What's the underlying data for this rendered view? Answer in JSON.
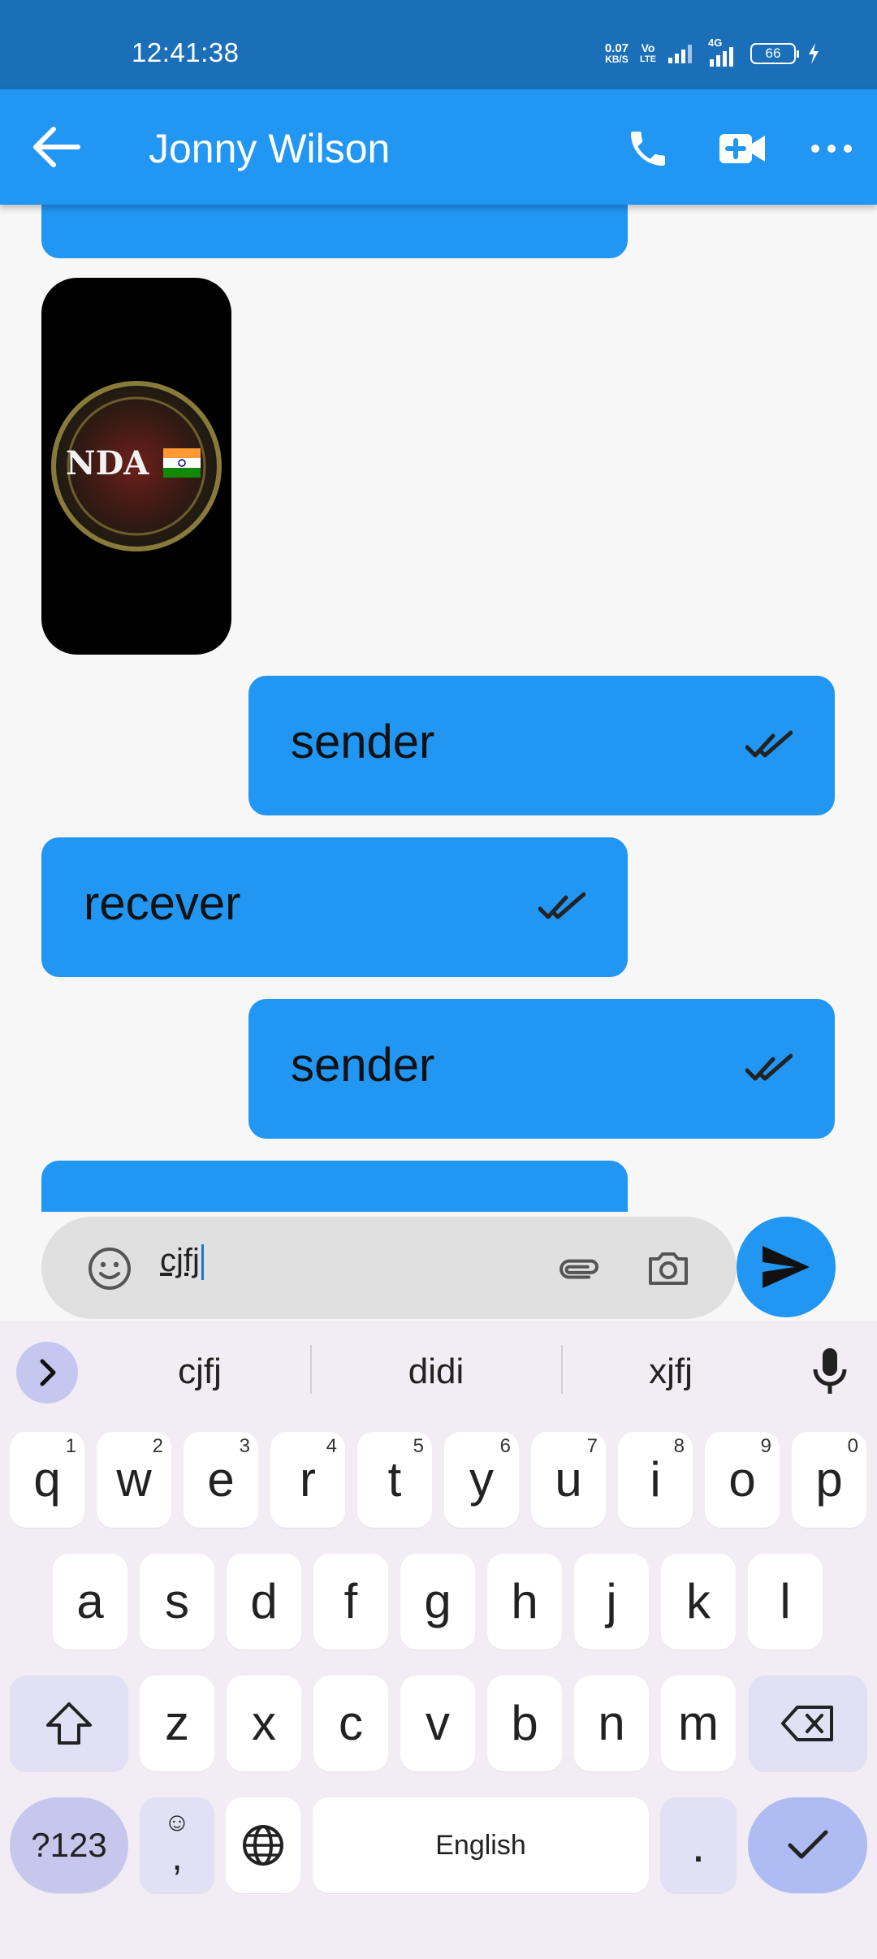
{
  "status_bar": {
    "time": "12:41:38",
    "net_speed_value": "0.07",
    "net_speed_unit": "KB/S",
    "volte_top": "Vo",
    "volte_bottom": "LTE",
    "network_4g": "4G",
    "battery": "66"
  },
  "app_bar": {
    "title": "Jonny Wilson",
    "back_icon": "arrow-left-icon",
    "call_icon": "phone-icon",
    "video_icon": "video-call-icon",
    "more_icon": "more-horizontal-icon",
    "color": "#2196f3"
  },
  "chat": {
    "image_message": {
      "logo_text": "NDA"
    },
    "messages": [
      {
        "text": "sender",
        "side": "right",
        "status": "read"
      },
      {
        "text": "recever",
        "side": "left",
        "status": "read"
      },
      {
        "text": "sender",
        "side": "right",
        "status": "read"
      }
    ]
  },
  "composer": {
    "input_value": "cjfj",
    "emoji_icon": "emoji-icon",
    "attach_icon": "paperclip-icon",
    "camera_icon": "camera-icon",
    "send_icon": "send-icon"
  },
  "keyboard": {
    "suggestions": [
      "cjfj",
      "didi",
      "xjfj"
    ],
    "row1": [
      {
        "k": "q",
        "h": "1"
      },
      {
        "k": "w",
        "h": "2"
      },
      {
        "k": "e",
        "h": "3"
      },
      {
        "k": "r",
        "h": "4"
      },
      {
        "k": "t",
        "h": "5"
      },
      {
        "k": "y",
        "h": "6"
      },
      {
        "k": "u",
        "h": "7"
      },
      {
        "k": "i",
        "h": "8"
      },
      {
        "k": "o",
        "h": "9"
      },
      {
        "k": "p",
        "h": "0"
      }
    ],
    "row2": [
      "a",
      "s",
      "d",
      "f",
      "g",
      "h",
      "j",
      "k",
      "l"
    ],
    "row3": [
      "z",
      "x",
      "c",
      "v",
      "b",
      "n",
      "m"
    ],
    "symbols_label": "?123",
    "emoji_comma_top": "☺",
    "emoji_comma_bottom": ",",
    "space_label": "English",
    "period_label": "."
  }
}
